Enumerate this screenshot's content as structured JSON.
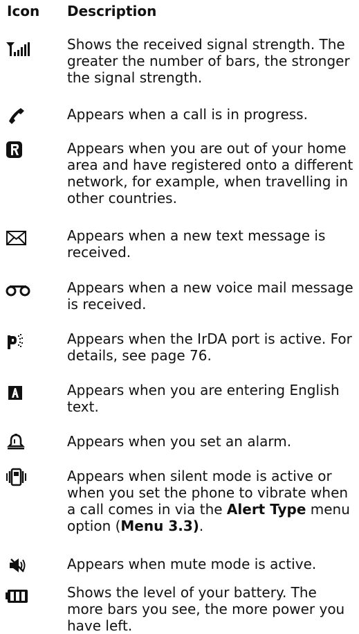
{
  "header": {
    "icon": "Icon",
    "description": "Description"
  },
  "rows": [
    {
      "icon": "signal-strength-icon",
      "text": "Shows the received signal strength. The greater the number of bars, the stronger the signal strength."
    },
    {
      "icon": "phone-handset-icon",
      "text": "Appears when a call is in progress."
    },
    {
      "icon": "roaming-icon",
      "text": "Appears when you are out of your home area and have registered onto a different network, for example, when travelling in other countries."
    },
    {
      "icon": "envelope-icon",
      "text": "Appears when a new text message is received."
    },
    {
      "icon": "voicemail-icon",
      "text": "Appears when a new voice mail message is received."
    },
    {
      "icon": "irda-port-icon",
      "text": "Appears when the IrDA port is active. For details, see page 76."
    },
    {
      "icon": "english-text-icon",
      "text": "Appears when you are entering English text."
    },
    {
      "icon": "alarm-bell-icon",
      "text": "Appears when you set an alarm."
    },
    {
      "icon": "vibrate-icon",
      "text_1": "Appears when silent mode is active or when you set the phone to vibrate when a call comes in via the ",
      "bold_1": "Alert Type",
      "text_2": " menu option (",
      "bold_2": "Menu 3.3)",
      "text_3": "."
    },
    {
      "icon": "mute-icon",
      "text": "Appears when mute mode is active."
    },
    {
      "icon": "battery-icon",
      "text": "Shows the level of your battery. The more bars you see, the more power you have left."
    }
  ]
}
